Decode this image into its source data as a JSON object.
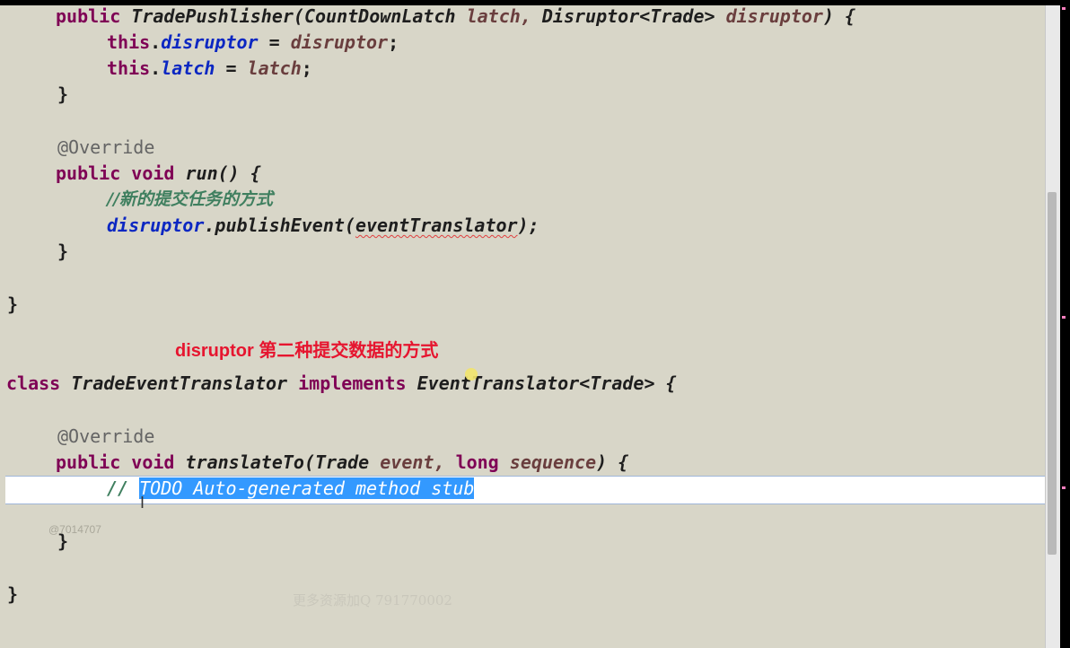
{
  "colors": {
    "editor_bg": "#d8d6c8",
    "keyword": "#7f0055",
    "field": "#0b27c2",
    "comment": "#3f7f5f",
    "selection": "#3399ff",
    "caption": "#e6152f"
  },
  "code": {
    "l1": {
      "kw": "public",
      "name": "TradePushlisher(CountDownLatch",
      "p1": "latch,",
      "t2": "Disruptor<Trade>",
      "p2": "disruptor",
      "end": ") {"
    },
    "l2": {
      "kw": "this",
      "dot": ".",
      "field": "disruptor",
      "eq": " = ",
      "val": "disruptor",
      "semi": ";"
    },
    "l3": {
      "kw": "this",
      "dot": ".",
      "field": "latch",
      "eq": " = ",
      "val": "latch",
      "semi": ";"
    },
    "l4": "}",
    "l5": "@Override",
    "l6": {
      "kw1": "public",
      "kw2": "void",
      "name": "run() {"
    },
    "l7": "//新的提交任务的方式",
    "l8": {
      "field": "disruptor",
      "call": ".publishEvent(",
      "arg": "eventTranslator",
      "end": ");"
    },
    "l9": "}",
    "l10": "}",
    "l11": {
      "kw1": "class",
      "name": "TradeEventTranslator",
      "kw2": "implements",
      "iface": "EventTranslator<Trade> {"
    },
    "l12": "@Override",
    "l13": {
      "kw1": "public",
      "kw2": "void",
      "name": "translateTo(Trade",
      "p1": "event,",
      "kw3": "long",
      "p2": "sequence",
      "end": ") {"
    },
    "l14": {
      "slashes": "// ",
      "selected": "TODO Auto-generated method stub"
    },
    "l15": "}",
    "l16": "}"
  },
  "caption": "disruptor 第二种提交数据的方式",
  "watermark_id": "@7014707",
  "watermark_text": "更多资源加Q 791770002",
  "cursor_glyph": "I"
}
